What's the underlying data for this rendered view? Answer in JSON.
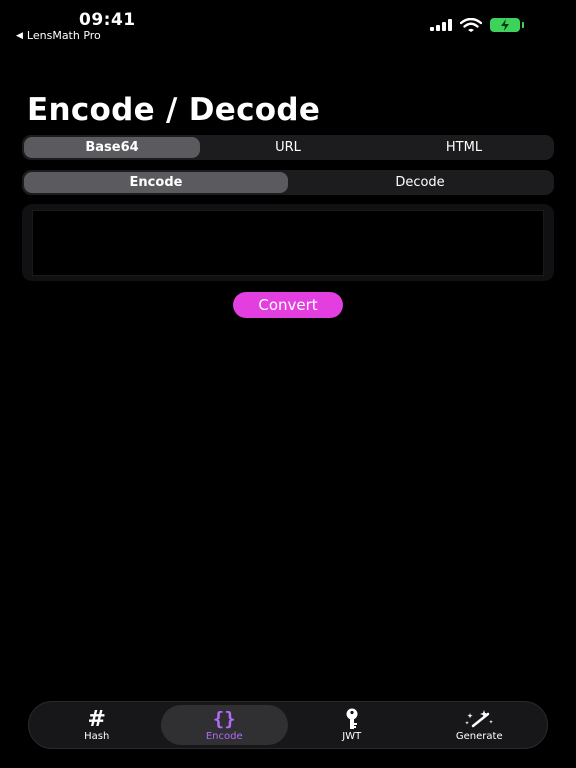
{
  "status_bar": {
    "time": "09:41",
    "back_label": "LensMath Pro",
    "back_arrow": "◀",
    "battery_color": "#3dd35b"
  },
  "page": {
    "title": "Encode / Decode"
  },
  "encoding_selector": {
    "options": [
      "Base64",
      "URL",
      "HTML"
    ],
    "selected": "Base64"
  },
  "mode_selector": {
    "options": [
      "Encode",
      "Decode"
    ],
    "selected": "Encode"
  },
  "input": {
    "value": "",
    "placeholder": ""
  },
  "convert_button": {
    "label": "Convert",
    "color": "#e33ee0"
  },
  "tab_bar": {
    "active_color": "#b26bf7",
    "tabs": [
      {
        "label": "Hash",
        "icon": "hash-icon",
        "glyph": "#"
      },
      {
        "label": "Encode",
        "icon": "braces-icon",
        "glyph": "{}"
      },
      {
        "label": "JWT",
        "icon": "key-icon"
      },
      {
        "label": "Generate",
        "icon": "magic-wand-icon"
      }
    ],
    "selected": "Encode"
  }
}
